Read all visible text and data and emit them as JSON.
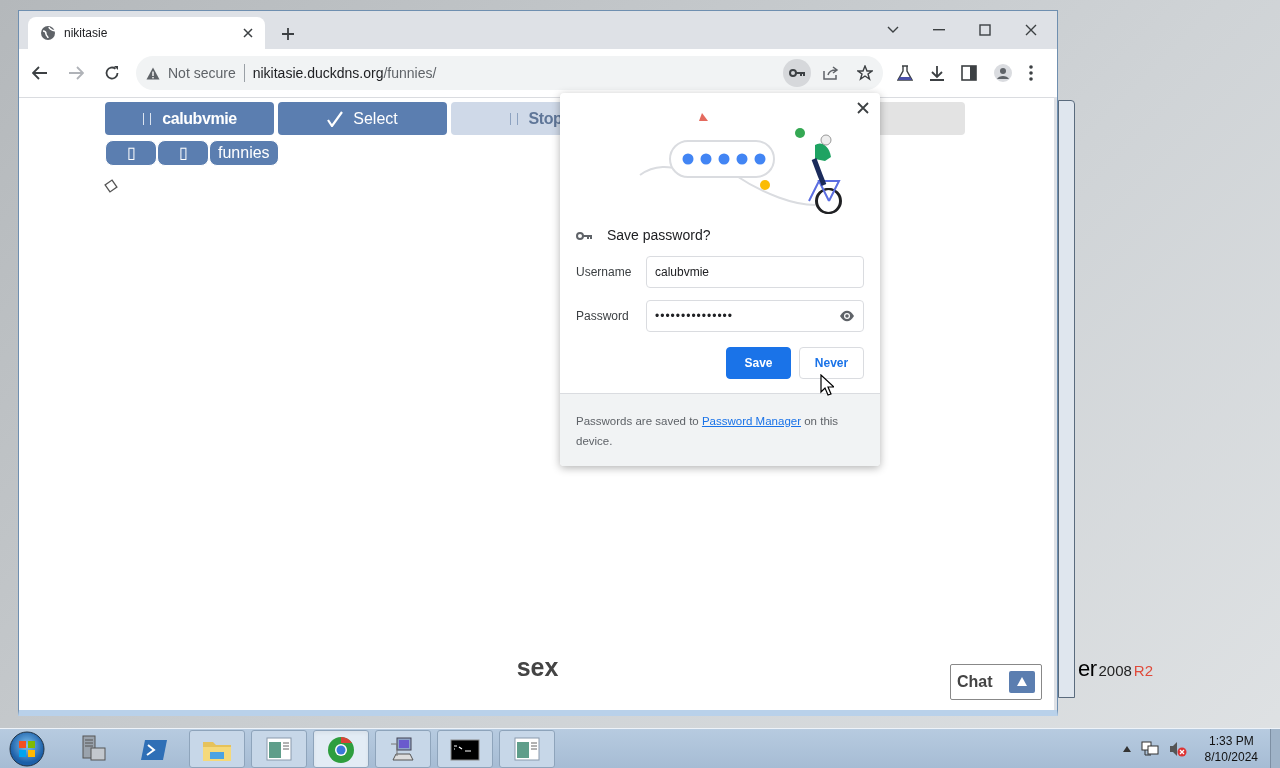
{
  "browser": {
    "tabs": [
      {
        "title": "nikitasie",
        "selected": true
      }
    ],
    "nav": {
      "forward_enabled": false
    },
    "address_bar": {
      "security": "Not secure",
      "host": "nikitasie.duckdns.org",
      "path": "/funnies/",
      "key_active": true
    }
  },
  "page": {
    "toolbar_buttons": [
      {
        "label": "calubvmie",
        "kind": "pause",
        "faded": false
      },
      {
        "label": "Select",
        "kind": "check",
        "faded": false
      },
      {
        "label": "Stop",
        "kind": "pause",
        "faded": true
      },
      {
        "kind": "blank",
        "faded": true
      }
    ],
    "tags": [
      {
        "label": "▯"
      },
      {
        "label": "▯"
      },
      {
        "label": "funnies"
      }
    ],
    "footer_word": "sex",
    "chat": {
      "label": "Chat"
    }
  },
  "password_popup": {
    "title": "Save password?",
    "fields": [
      {
        "label": "Username",
        "value": "calubvmie",
        "kind": "text"
      },
      {
        "label": "Password",
        "value": "•••••••••••••••",
        "kind": "password"
      }
    ],
    "buttons": [
      {
        "label": "Save",
        "kind": "primary"
      },
      {
        "label": "Never",
        "kind": "secondary"
      }
    ],
    "note": {
      "before": "Passwords are saved to",
      "link": "Password Manager",
      "after": "on this device."
    }
  },
  "desktop": {
    "brand": {
      "name": "er",
      "version": "2008",
      "edition": "R2"
    }
  },
  "taskbar": {
    "items": [
      {
        "kind": "server",
        "open": false,
        "selected": false
      },
      {
        "kind": "powershell",
        "open": false,
        "selected": false
      },
      {
        "kind": "folder",
        "open": true,
        "selected": false
      },
      {
        "kind": "app",
        "open": true,
        "selected": false
      },
      {
        "kind": "chrome",
        "open": true,
        "selected": true
      },
      {
        "kind": "network",
        "open": true,
        "selected": false
      },
      {
        "kind": "cmd",
        "open": true,
        "selected": false
      },
      {
        "kind": "app",
        "open": true,
        "selected": false
      }
    ],
    "clock": {
      "time": "1:33 PM",
      "date": "8/10/2024"
    }
  }
}
